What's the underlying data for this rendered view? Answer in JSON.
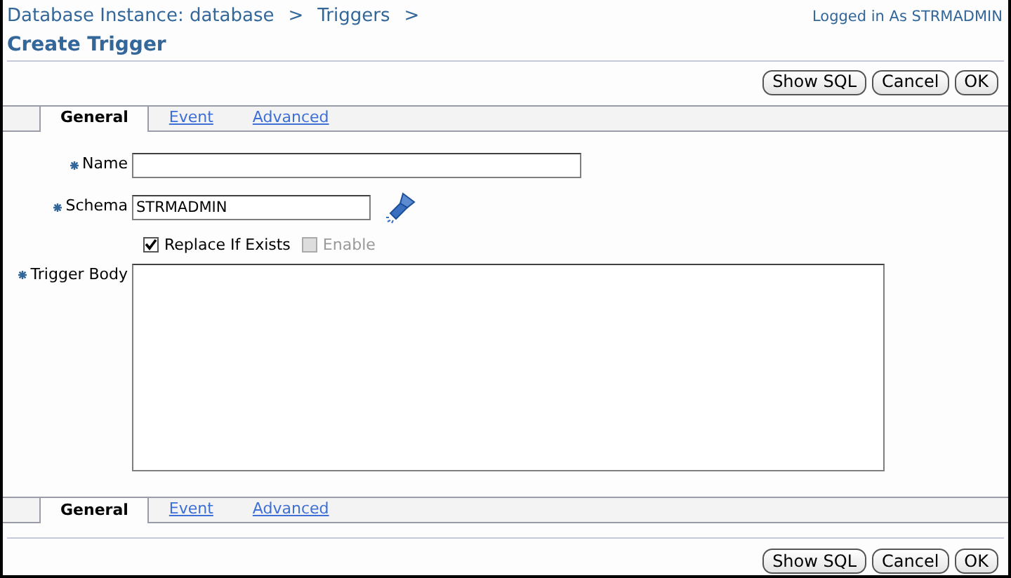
{
  "breadcrumb": [
    {
      "label": "Database Instance: database",
      "separator": ">"
    },
    {
      "label": "Triggers",
      "separator": ">"
    }
  ],
  "page_title": "Create Trigger",
  "user_info": "Logged in As STRMADMIN",
  "top_buttons": [
    "Show SQL",
    "Cancel",
    "OK"
  ],
  "top_tabs": [
    {
      "label": "General",
      "selected": true
    },
    {
      "label": "Event",
      "selected": false
    },
    {
      "label": "Advanced",
      "selected": false
    }
  ],
  "form": {
    "name": {
      "label": "Name",
      "required": true
    },
    "schema": {
      "label": "Schema",
      "required": true,
      "value": "STRMADMIN"
    },
    "options": [
      {
        "label": "Replace If Exists",
        "checked": true,
        "disabled": false
      },
      {
        "label": "Enable",
        "checked": false,
        "disabled": true
      }
    ],
    "trigger_body": {
      "label": "Trigger Body",
      "required": true
    }
  },
  "bottom_tabs": [
    {
      "label": "General",
      "selected": true
    },
    {
      "label": "Event",
      "selected": false
    },
    {
      "label": "Advanced",
      "selected": false
    }
  ],
  "bottom_buttons": [
    "Show SQL",
    "Cancel",
    "OK"
  ]
}
